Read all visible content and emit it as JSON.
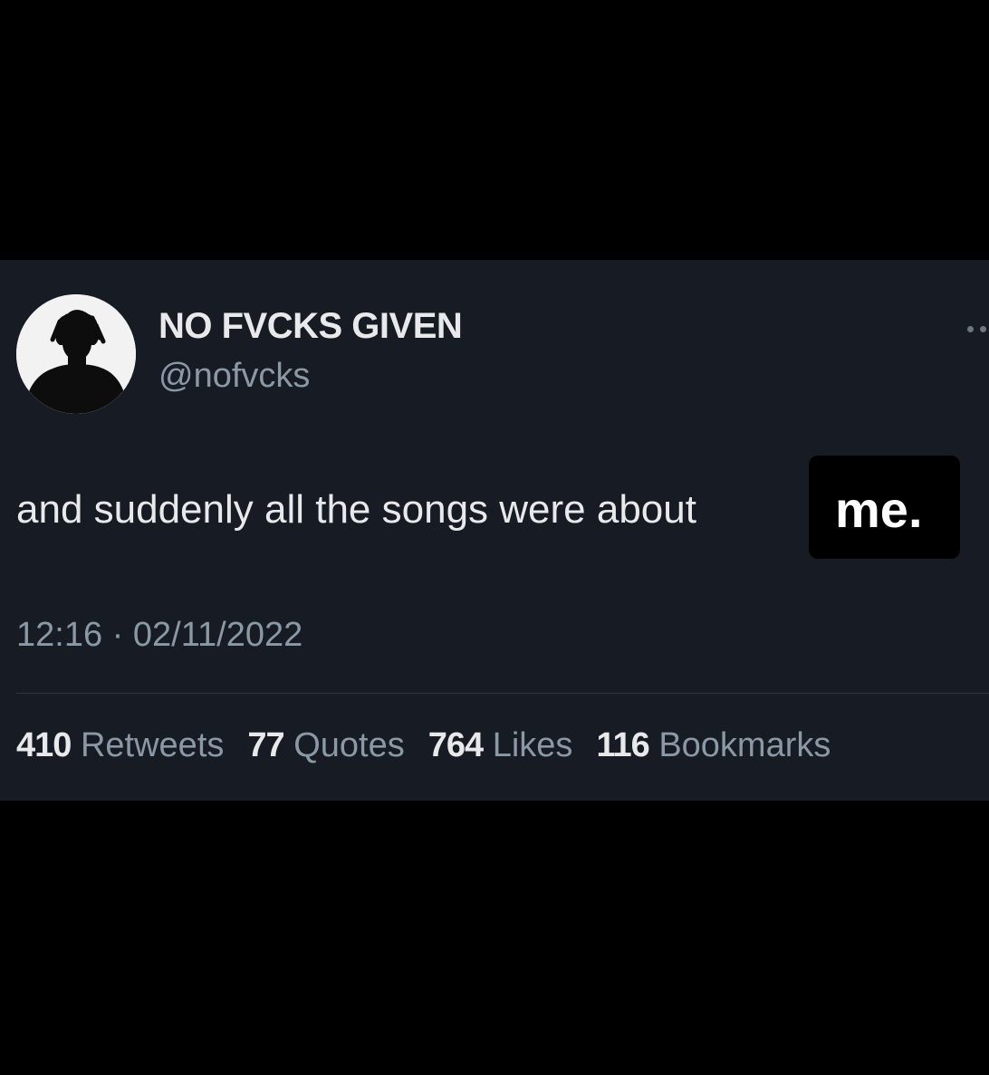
{
  "tweet": {
    "display_name": "NO FVCKS GIVEN",
    "handle": "@nofvcks",
    "text": "and suddenly all the songs were about",
    "highlight": "me.",
    "timestamp": "12:16 · 02/11/2022",
    "stats": [
      {
        "count": "410",
        "label": "Retweets"
      },
      {
        "count": "77",
        "label": "Quotes"
      },
      {
        "count": "764",
        "label": "Likes"
      },
      {
        "count": "116",
        "label": "Bookmarks"
      }
    ]
  },
  "colors": {
    "page_background": "#000000",
    "card_background": "#161b24",
    "primary_text": "#e7e9ea",
    "secondary_text": "#8b98a5"
  },
  "icons": {
    "more": "more-horizontal-icon",
    "avatar": "avatar-silhouette"
  }
}
